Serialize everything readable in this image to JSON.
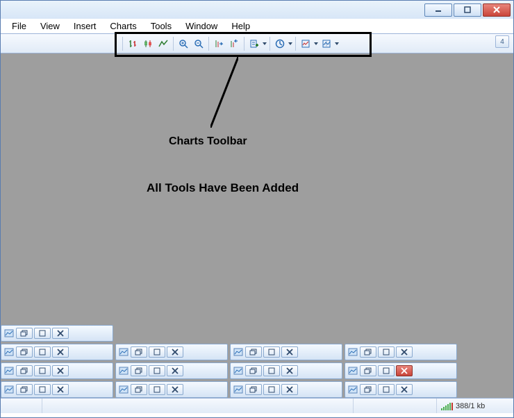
{
  "menubar": {
    "items": [
      "File",
      "View",
      "Insert",
      "Charts",
      "Tools",
      "Window",
      "Help"
    ]
  },
  "toolbar": {
    "icons": {
      "bar_chart": "bar-chart-icon",
      "candles": "candlestick-icon",
      "line_chart": "line-chart-icon",
      "zoom_in": "zoom-in-icon",
      "zoom_out": "zoom-out-icon",
      "auto_scroll": "auto-scroll-icon",
      "chart_shift": "chart-shift-icon",
      "indicators": "indicators-icon",
      "periods": "periods-icon",
      "templates": "templates-icon",
      "grid": "grid-icon"
    },
    "right_indicator": "4"
  },
  "annotations": {
    "title": "Charts Toolbar",
    "subtitle": "All Tools Have Been Added"
  },
  "status": {
    "traffic": "388/1 kb"
  },
  "chart_stubs_rows": [
    1,
    4,
    4,
    4
  ]
}
